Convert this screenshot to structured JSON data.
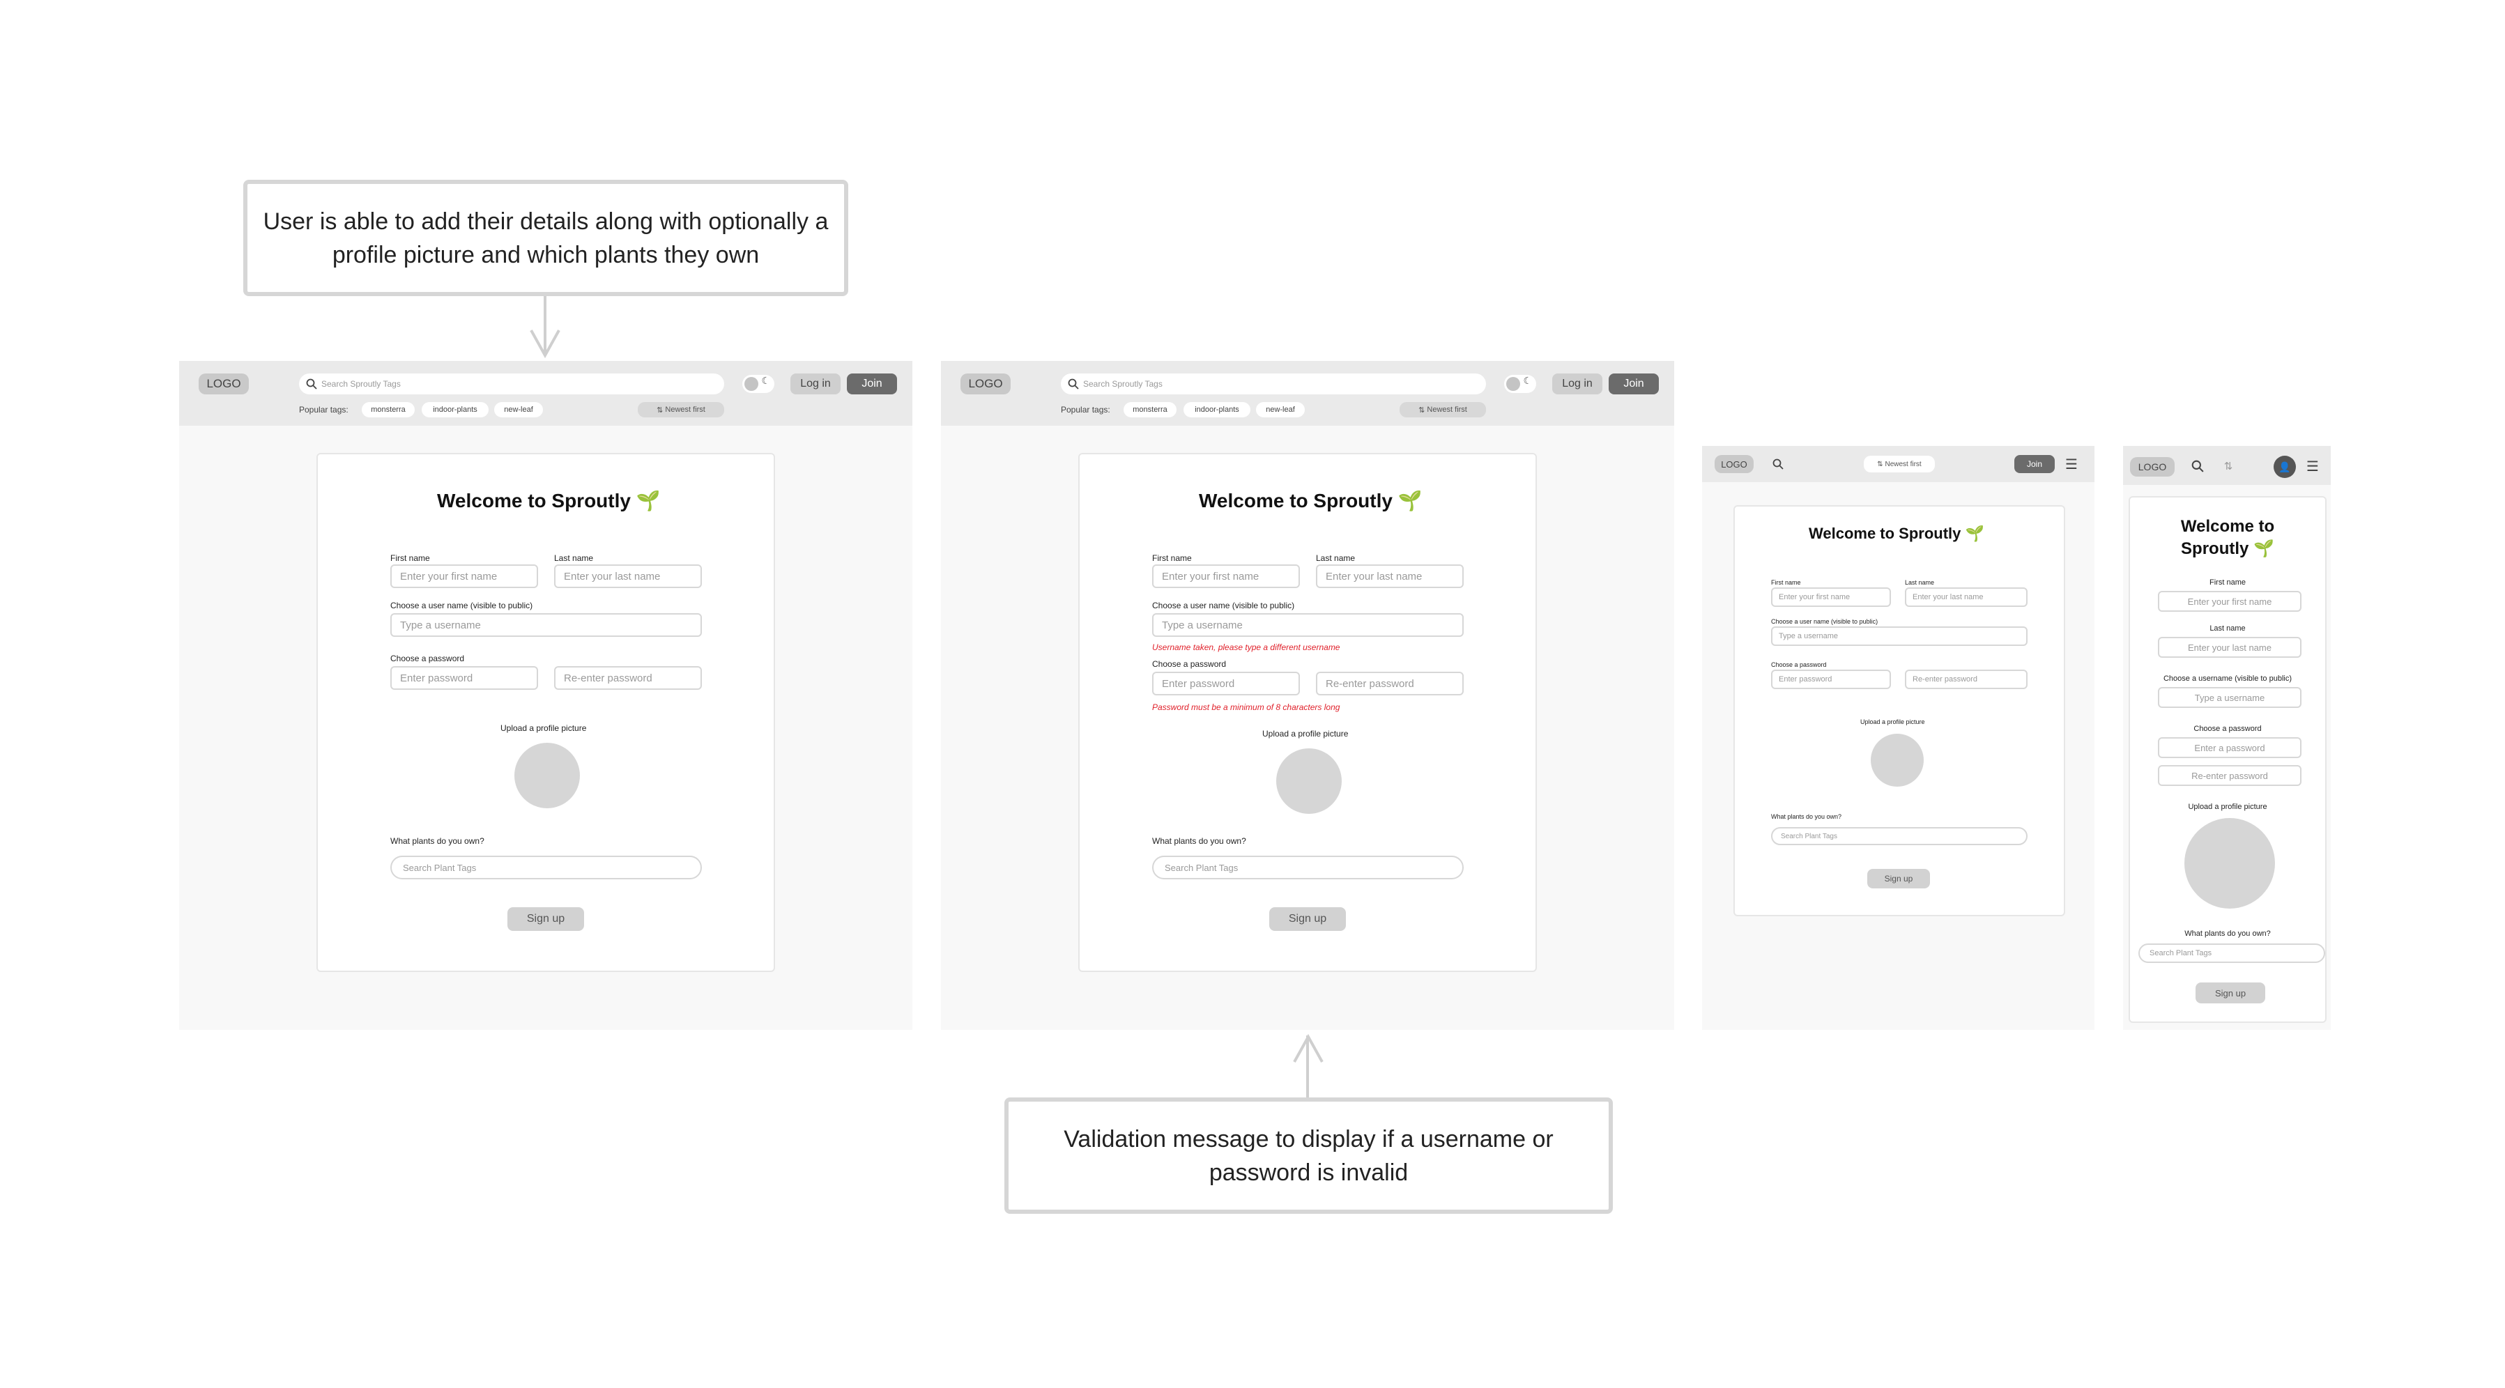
{
  "annotations": {
    "top": "User is able to add their details along with optionally a profile picture and which plants they own",
    "bottom": "Validation message to display if a username or password is invalid"
  },
  "header": {
    "logo": "LOGO",
    "search_placeholder": "Search Sproutly Tags",
    "login": "Log in",
    "join": "Join",
    "popular_label": "Popular tags:",
    "tags": [
      "monsterra",
      "indoor-plants",
      "new-leaf"
    ],
    "sort": "Newest first"
  },
  "form": {
    "title": "Welcome to Sproutly",
    "title_line1": "Welcome to",
    "title_line2": "Sproutly",
    "first_name_label": "First name",
    "first_name_placeholder": "Enter your first name",
    "last_name_label": "Last name",
    "last_name_placeholder": "Enter your last name",
    "username_label": "Choose a user name (visible to public)",
    "username_label_mobile": "Choose a username (visible to public)",
    "username_placeholder": "Type a username",
    "password_label": "Choose a password",
    "password_placeholder": "Enter password",
    "password_placeholder_mobile": "Enter a password",
    "reenter_placeholder": "Re-enter password",
    "upload_label": "Upload a profile picture",
    "plants_label": "What plants do you own?",
    "plants_placeholder": "Search Plant Tags",
    "signup": "Sign up"
  },
  "errors": {
    "username": "Username taken, please type a different username",
    "password": "Password must be a minimum of 8 characters long"
  },
  "colors": {
    "error": "#e0202a",
    "sprout": "#6bb83a",
    "join_button": "#6b6b6b"
  }
}
